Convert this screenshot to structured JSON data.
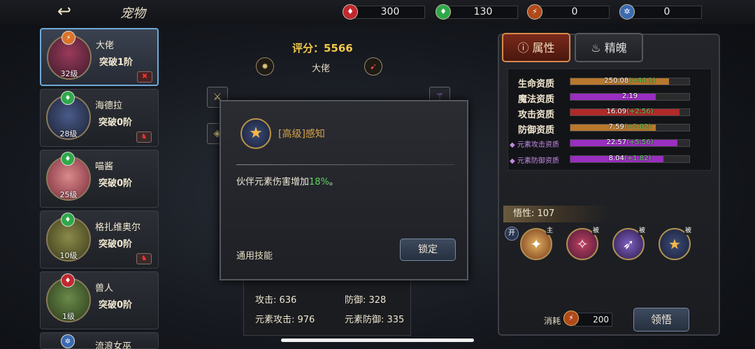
{
  "header": {
    "title": "宠物",
    "back_icon": "back-arrow-icon"
  },
  "resources": [
    {
      "icon": "red-gem-icon",
      "color": "#c0282e",
      "value": "300"
    },
    {
      "icon": "green-gem-icon",
      "color": "#2fa84a",
      "value": "130"
    },
    {
      "icon": "lightning-coin-icon",
      "color": "#b0491a",
      "value": "0"
    },
    {
      "icon": "snowflake-icon",
      "color": "#3a6ab0",
      "value": "0"
    }
  ],
  "pets": [
    {
      "name": "大佬",
      "breakthrough": "突破1阶",
      "level": "32级",
      "badge_color": "#d9732a",
      "selected": true
    },
    {
      "name": "海德拉",
      "breakthrough": "突破0阶",
      "level": "28级",
      "badge_color": "#2fa84a"
    },
    {
      "name": "喵酱",
      "breakthrough": "突破0阶",
      "level": "25级",
      "badge_color": "#2fa84a"
    },
    {
      "name": "格扎维奥尔",
      "breakthrough": "突破0阶",
      "level": "10级",
      "badge_color": "#2fa84a"
    },
    {
      "name": "兽人",
      "breakthrough": "突破0阶",
      "level": "1级",
      "badge_color": "#c0282e"
    },
    {
      "name": "流浪女巫",
      "badge_color": "#3a6ab0"
    }
  ],
  "center": {
    "score": "评分：5566",
    "char_name": "大佬",
    "stats": {
      "attack": "攻击: 636",
      "defense": "防御: 328",
      "elem_attack": "元素攻击: 976",
      "elem_defense": "元素防御: 335"
    }
  },
  "popup": {
    "skill_title": "[高级]感知",
    "desc_prefix": "伙伴元素伤害增加",
    "desc_value": "18%",
    "desc_suffix": "。",
    "skill_type": "通用技能",
    "lock_label": "锁定"
  },
  "tabs": {
    "attributes": "属性",
    "soul": "精魄"
  },
  "attributes": [
    {
      "label": "生命资质",
      "value": "250.08",
      "bonus": "(+44.1)",
      "fill": 0.83,
      "color": "#b8782e"
    },
    {
      "label": "魔法资质",
      "value": "2.19",
      "bonus": "",
      "fill": 0.72,
      "color": "#9a2ec0"
    },
    {
      "label": "攻击资质",
      "value": "16.09",
      "bonus": "(+2.56)",
      "fill": 0.92,
      "color": "#b02a2a"
    },
    {
      "label": "防御资质",
      "value": "7.59",
      "bonus": "(+2.02)",
      "fill": 0.72,
      "color": "#b8782e"
    },
    {
      "label": "◆ 元素攻击资质",
      "value": "22.57",
      "bonus": "(+5.56)",
      "fill": 0.9,
      "color": "#9a2ec0",
      "element": true
    },
    {
      "label": "◆ 元素防御资质",
      "value": "8.04",
      "bonus": "(+1.82)",
      "fill": 0.78,
      "color": "#9a2ec0",
      "element": true
    }
  ],
  "wuxing": "悟性: 107",
  "skills": [
    {
      "mark": "主",
      "icon": "main-skill-icon"
    },
    {
      "mark": "被",
      "icon": "passive-skill-icon"
    },
    {
      "mark": "被",
      "icon": "passive-skill-icon"
    },
    {
      "mark": "被",
      "icon": "passive-skill-icon"
    }
  ],
  "open_label": "开",
  "cost": {
    "label": "消耗",
    "value": "200"
  },
  "lingwu_label": "领悟"
}
